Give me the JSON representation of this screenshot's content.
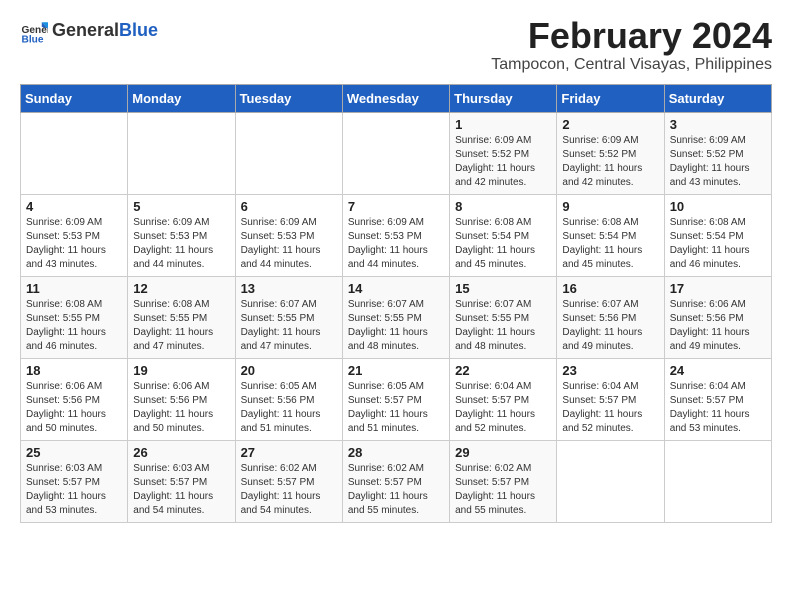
{
  "header": {
    "logo_general": "General",
    "logo_blue": "Blue",
    "main_title": "February 2024",
    "subtitle": "Tampocon, Central Visayas, Philippines"
  },
  "calendar": {
    "weekdays": [
      "Sunday",
      "Monday",
      "Tuesday",
      "Wednesday",
      "Thursday",
      "Friday",
      "Saturday"
    ],
    "weeks": [
      [
        {
          "day": "",
          "sunrise": "",
          "sunset": "",
          "daylight": ""
        },
        {
          "day": "",
          "sunrise": "",
          "sunset": "",
          "daylight": ""
        },
        {
          "day": "",
          "sunrise": "",
          "sunset": "",
          "daylight": ""
        },
        {
          "day": "",
          "sunrise": "",
          "sunset": "",
          "daylight": ""
        },
        {
          "day": "1",
          "sunrise": "Sunrise: 6:09 AM",
          "sunset": "Sunset: 5:52 PM",
          "daylight": "Daylight: 11 hours and 42 minutes."
        },
        {
          "day": "2",
          "sunrise": "Sunrise: 6:09 AM",
          "sunset": "Sunset: 5:52 PM",
          "daylight": "Daylight: 11 hours and 42 minutes."
        },
        {
          "day": "3",
          "sunrise": "Sunrise: 6:09 AM",
          "sunset": "Sunset: 5:52 PM",
          "daylight": "Daylight: 11 hours and 43 minutes."
        }
      ],
      [
        {
          "day": "4",
          "sunrise": "Sunrise: 6:09 AM",
          "sunset": "Sunset: 5:53 PM",
          "daylight": "Daylight: 11 hours and 43 minutes."
        },
        {
          "day": "5",
          "sunrise": "Sunrise: 6:09 AM",
          "sunset": "Sunset: 5:53 PM",
          "daylight": "Daylight: 11 hours and 44 minutes."
        },
        {
          "day": "6",
          "sunrise": "Sunrise: 6:09 AM",
          "sunset": "Sunset: 5:53 PM",
          "daylight": "Daylight: 11 hours and 44 minutes."
        },
        {
          "day": "7",
          "sunrise": "Sunrise: 6:09 AM",
          "sunset": "Sunset: 5:53 PM",
          "daylight": "Daylight: 11 hours and 44 minutes."
        },
        {
          "day": "8",
          "sunrise": "Sunrise: 6:08 AM",
          "sunset": "Sunset: 5:54 PM",
          "daylight": "Daylight: 11 hours and 45 minutes."
        },
        {
          "day": "9",
          "sunrise": "Sunrise: 6:08 AM",
          "sunset": "Sunset: 5:54 PM",
          "daylight": "Daylight: 11 hours and 45 minutes."
        },
        {
          "day": "10",
          "sunrise": "Sunrise: 6:08 AM",
          "sunset": "Sunset: 5:54 PM",
          "daylight": "Daylight: 11 hours and 46 minutes."
        }
      ],
      [
        {
          "day": "11",
          "sunrise": "Sunrise: 6:08 AM",
          "sunset": "Sunset: 5:55 PM",
          "daylight": "Daylight: 11 hours and 46 minutes."
        },
        {
          "day": "12",
          "sunrise": "Sunrise: 6:08 AM",
          "sunset": "Sunset: 5:55 PM",
          "daylight": "Daylight: 11 hours and 47 minutes."
        },
        {
          "day": "13",
          "sunrise": "Sunrise: 6:07 AM",
          "sunset": "Sunset: 5:55 PM",
          "daylight": "Daylight: 11 hours and 47 minutes."
        },
        {
          "day": "14",
          "sunrise": "Sunrise: 6:07 AM",
          "sunset": "Sunset: 5:55 PM",
          "daylight": "Daylight: 11 hours and 48 minutes."
        },
        {
          "day": "15",
          "sunrise": "Sunrise: 6:07 AM",
          "sunset": "Sunset: 5:55 PM",
          "daylight": "Daylight: 11 hours and 48 minutes."
        },
        {
          "day": "16",
          "sunrise": "Sunrise: 6:07 AM",
          "sunset": "Sunset: 5:56 PM",
          "daylight": "Daylight: 11 hours and 49 minutes."
        },
        {
          "day": "17",
          "sunrise": "Sunrise: 6:06 AM",
          "sunset": "Sunset: 5:56 PM",
          "daylight": "Daylight: 11 hours and 49 minutes."
        }
      ],
      [
        {
          "day": "18",
          "sunrise": "Sunrise: 6:06 AM",
          "sunset": "Sunset: 5:56 PM",
          "daylight": "Daylight: 11 hours and 50 minutes."
        },
        {
          "day": "19",
          "sunrise": "Sunrise: 6:06 AM",
          "sunset": "Sunset: 5:56 PM",
          "daylight": "Daylight: 11 hours and 50 minutes."
        },
        {
          "day": "20",
          "sunrise": "Sunrise: 6:05 AM",
          "sunset": "Sunset: 5:56 PM",
          "daylight": "Daylight: 11 hours and 51 minutes."
        },
        {
          "day": "21",
          "sunrise": "Sunrise: 6:05 AM",
          "sunset": "Sunset: 5:57 PM",
          "daylight": "Daylight: 11 hours and 51 minutes."
        },
        {
          "day": "22",
          "sunrise": "Sunrise: 6:04 AM",
          "sunset": "Sunset: 5:57 PM",
          "daylight": "Daylight: 11 hours and 52 minutes."
        },
        {
          "day": "23",
          "sunrise": "Sunrise: 6:04 AM",
          "sunset": "Sunset: 5:57 PM",
          "daylight": "Daylight: 11 hours and 52 minutes."
        },
        {
          "day": "24",
          "sunrise": "Sunrise: 6:04 AM",
          "sunset": "Sunset: 5:57 PM",
          "daylight": "Daylight: 11 hours and 53 minutes."
        }
      ],
      [
        {
          "day": "25",
          "sunrise": "Sunrise: 6:03 AM",
          "sunset": "Sunset: 5:57 PM",
          "daylight": "Daylight: 11 hours and 53 minutes."
        },
        {
          "day": "26",
          "sunrise": "Sunrise: 6:03 AM",
          "sunset": "Sunset: 5:57 PM",
          "daylight": "Daylight: 11 hours and 54 minutes."
        },
        {
          "day": "27",
          "sunrise": "Sunrise: 6:02 AM",
          "sunset": "Sunset: 5:57 PM",
          "daylight": "Daylight: 11 hours and 54 minutes."
        },
        {
          "day": "28",
          "sunrise": "Sunrise: 6:02 AM",
          "sunset": "Sunset: 5:57 PM",
          "daylight": "Daylight: 11 hours and 55 minutes."
        },
        {
          "day": "29",
          "sunrise": "Sunrise: 6:02 AM",
          "sunset": "Sunset: 5:57 PM",
          "daylight": "Daylight: 11 hours and 55 minutes."
        },
        {
          "day": "",
          "sunrise": "",
          "sunset": "",
          "daylight": ""
        },
        {
          "day": "",
          "sunrise": "",
          "sunset": "",
          "daylight": ""
        }
      ]
    ]
  }
}
